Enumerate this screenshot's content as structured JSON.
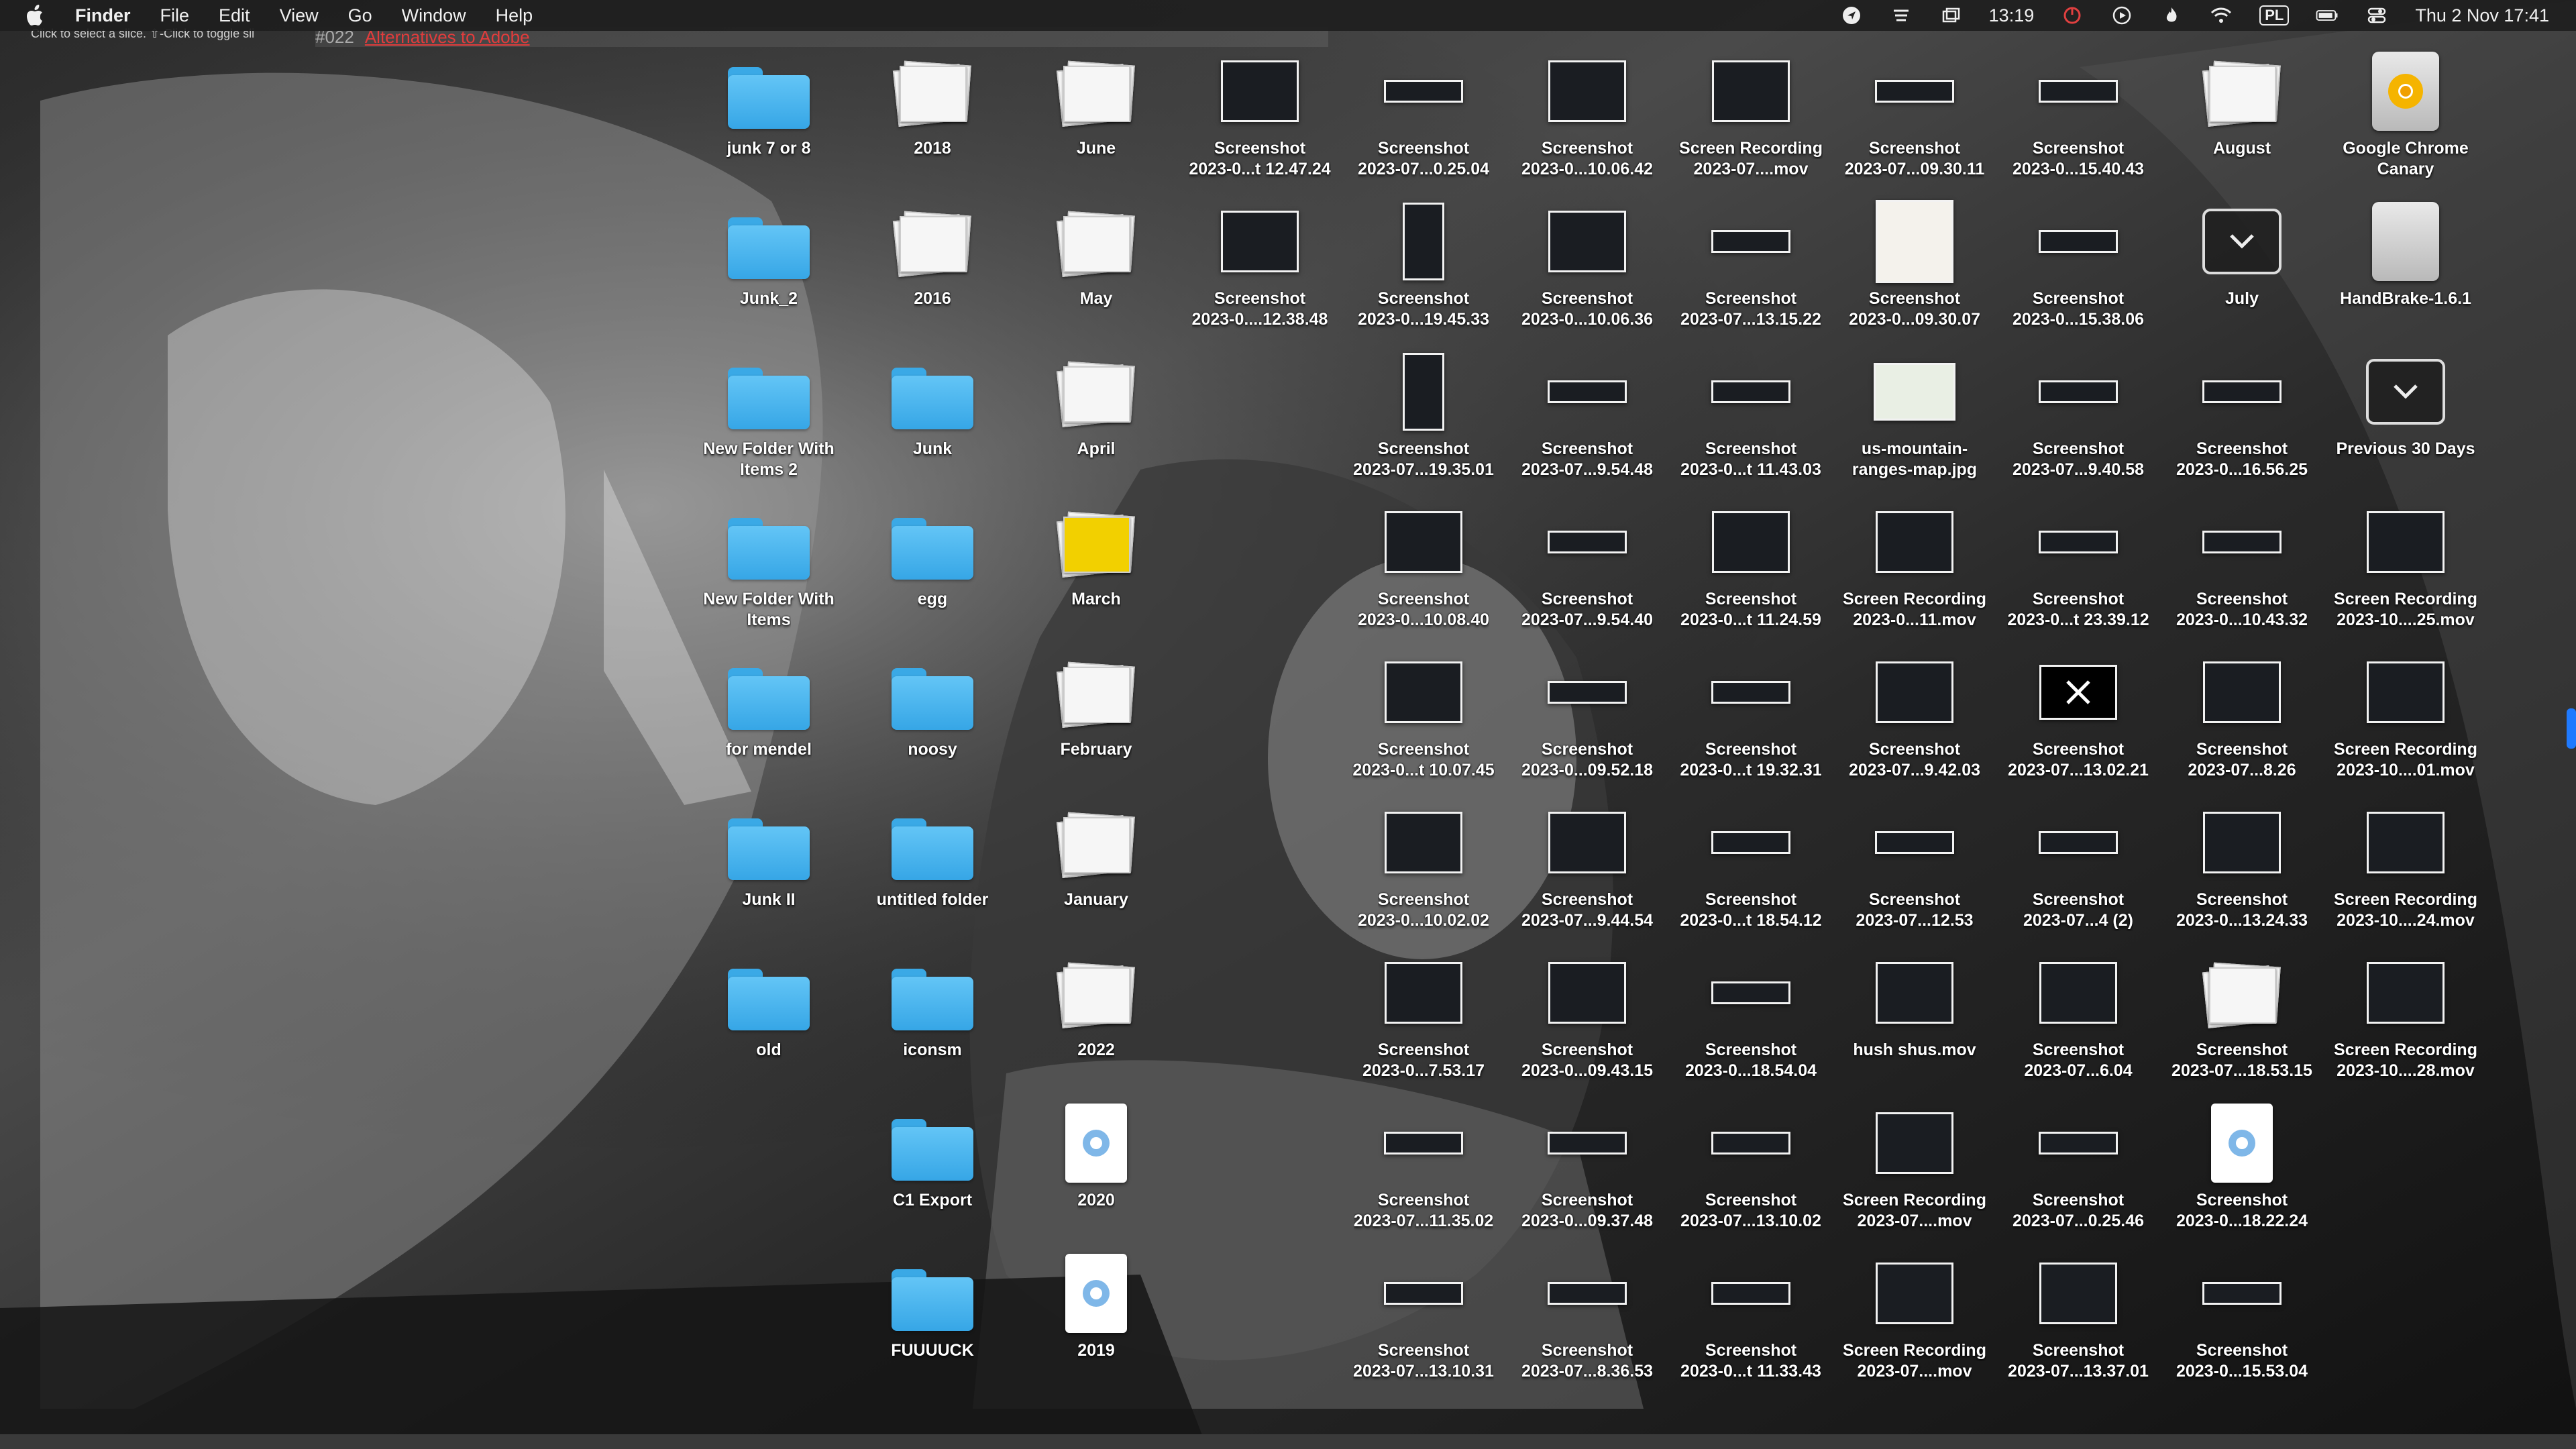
{
  "menubar": {
    "app": "Finder",
    "menus": [
      "File",
      "Edit",
      "View",
      "Go",
      "Window",
      "Help"
    ],
    "time": "13:19",
    "input_source": "PL",
    "clock": "Thu 2 Nov  17:41"
  },
  "ghost": {
    "tab_number": "#022",
    "tab_link": "Alternatives to Adobe",
    "hint": "Click to select a slice. ⇧-Click to toggle sli"
  },
  "desktop": {
    "columns": [
      {
        "items": [
          {
            "label": "junk 7 or 8",
            "label2": "",
            "kind": "folder"
          },
          {
            "label": "Junk_2",
            "label2": "",
            "kind": "folder"
          },
          {
            "label": "New Folder With",
            "label2": "Items 2",
            "kind": "folder"
          },
          {
            "label": "New Folder With",
            "label2": "Items",
            "kind": "folder"
          },
          {
            "label": "for mendel",
            "label2": "",
            "kind": "folder"
          },
          {
            "label": "Junk II",
            "label2": "",
            "kind": "folder"
          },
          {
            "label": "old",
            "label2": "",
            "kind": "folder"
          }
        ]
      },
      {
        "items": [
          {
            "label": "2018",
            "label2": "",
            "kind": "stack"
          },
          {
            "label": "2016",
            "label2": "",
            "kind": "stack"
          },
          {
            "label": "Junk",
            "label2": "",
            "kind": "folder"
          },
          {
            "label": "egg",
            "label2": "",
            "kind": "folder"
          },
          {
            "label": "noosy",
            "label2": "",
            "kind": "folder"
          },
          {
            "label": "untitled folder",
            "label2": "",
            "kind": "folder"
          },
          {
            "label": "iconsm",
            "label2": "",
            "kind": "folder"
          },
          {
            "label": "C1 Export",
            "label2": "",
            "kind": "folder"
          },
          {
            "label": "FUUUUCK",
            "label2": "",
            "kind": "folder"
          }
        ]
      },
      {
        "items": [
          {
            "label": "June",
            "label2": "",
            "kind": "stack"
          },
          {
            "label": "May",
            "label2": "",
            "kind": "stack"
          },
          {
            "label": "April",
            "label2": "",
            "kind": "stack"
          },
          {
            "label": "March",
            "label2": "",
            "kind": "stack-yellow"
          },
          {
            "label": "February",
            "label2": "",
            "kind": "stack"
          },
          {
            "label": "January",
            "label2": "",
            "kind": "stack"
          },
          {
            "label": "2022",
            "label2": "",
            "kind": "stack"
          },
          {
            "label": "2020",
            "label2": "",
            "kind": "doc"
          },
          {
            "label": "2019",
            "label2": "",
            "kind": "doc"
          }
        ]
      },
      {
        "items": [
          {
            "label": "Screenshot",
            "label2": "2023-0...t 12.47.24",
            "kind": "shot"
          },
          {
            "label": "Screenshot",
            "label2": "2023-0....12.38.48",
            "kind": "shot"
          }
        ]
      },
      {
        "items": [
          {
            "label": "Screenshot",
            "label2": "2023-07...0.25.04",
            "kind": "shot-thin"
          },
          {
            "label": "Screenshot",
            "label2": "2023-0...19.45.33",
            "kind": "shot-tall"
          },
          {
            "label": "Screenshot",
            "label2": "2023-07...19.35.01",
            "kind": "shot-tall"
          },
          {
            "label": "Screenshot",
            "label2": "2023-0...10.08.40",
            "kind": "shot"
          },
          {
            "label": "Screenshot",
            "label2": "2023-0...t 10.07.45",
            "kind": "shot"
          },
          {
            "label": "Screenshot",
            "label2": "2023-0...10.02.02",
            "kind": "shot"
          },
          {
            "label": "Screenshot",
            "label2": "2023-0...7.53.17",
            "kind": "shot"
          },
          {
            "label": "Screenshot",
            "label2": "2023-07...11.35.02",
            "kind": "shot-thin"
          },
          {
            "label": "Screenshot",
            "label2": "2023-07...13.10.31",
            "kind": "shot-thin"
          }
        ]
      },
      {
        "items": [
          {
            "label": "Screenshot",
            "label2": "2023-0...10.06.42",
            "kind": "shot"
          },
          {
            "label": "Screenshot",
            "label2": "2023-0...10.06.36",
            "kind": "shot"
          },
          {
            "label": "Screenshot",
            "label2": "2023-07...9.54.48",
            "kind": "shot-thin"
          },
          {
            "label": "Screenshot",
            "label2": "2023-07...9.54.40",
            "kind": "shot-thin"
          },
          {
            "label": "Screenshot",
            "label2": "2023-0...09.52.18",
            "kind": "shot-thin"
          },
          {
            "label": "Screenshot",
            "label2": "2023-07...9.44.54",
            "kind": "shot"
          },
          {
            "label": "Screenshot",
            "label2": "2023-0...09.43.15",
            "kind": "shot"
          },
          {
            "label": "Screenshot",
            "label2": "2023-0...09.37.48",
            "kind": "shot-thin"
          },
          {
            "label": "Screenshot",
            "label2": "2023-07...8.36.53",
            "kind": "shot-thin"
          }
        ]
      },
      {
        "items": [
          {
            "label": "Screen Recording",
            "label2": "2023-07....mov",
            "kind": "shot"
          },
          {
            "label": "Screenshot",
            "label2": "2023-07...13.15.22",
            "kind": "shot-thin"
          },
          {
            "label": "Screenshot",
            "label2": "2023-0...t 11.43.03",
            "kind": "shot-thin"
          },
          {
            "label": "Screenshot",
            "label2": "2023-0...t 11.24.59",
            "kind": "shot"
          },
          {
            "label": "Screenshot",
            "label2": "2023-0...t 19.32.31",
            "kind": "shot-thin"
          },
          {
            "label": "Screenshot",
            "label2": "2023-0...t 18.54.12",
            "kind": "shot-thin"
          },
          {
            "label": "Screenshot",
            "label2": "2023-0...18.54.04",
            "kind": "shot-thin"
          },
          {
            "label": "Screenshot",
            "label2": "2023-07...13.10.02",
            "kind": "shot-thin"
          },
          {
            "label": "Screenshot",
            "label2": "2023-0...t 11.33.43",
            "kind": "shot-thin"
          }
        ]
      },
      {
        "items": [
          {
            "label": "Screenshot",
            "label2": "2023-07...09.30.11",
            "kind": "shot-thin"
          },
          {
            "label": "Screenshot",
            "label2": "2023-0...09.30.07",
            "kind": "blank"
          },
          {
            "label": "us-mountain-",
            "label2": "ranges-map.jpg",
            "kind": "map"
          },
          {
            "label": "Screen Recording",
            "label2": "2023-0...11.mov",
            "kind": "shot"
          },
          {
            "label": "Screenshot",
            "label2": "2023-07...9.42.03",
            "kind": "shot"
          },
          {
            "label": "Screenshot",
            "label2": "2023-07...12.53",
            "kind": "shot-thin"
          },
          {
            "label": "hush shus.mov",
            "label2": "",
            "kind": "shot"
          },
          {
            "label": "Screen Recording",
            "label2": "2023-07....mov",
            "kind": "shot"
          },
          {
            "label": "Screen Recording",
            "label2": "2023-07....mov",
            "kind": "shot"
          }
        ]
      },
      {
        "items": [
          {
            "label": "Screenshot",
            "label2": "2023-0...15.40.43",
            "kind": "shot-thin"
          },
          {
            "label": "Screenshot",
            "label2": "2023-0...15.38.06",
            "kind": "shot-thin"
          },
          {
            "label": "Screenshot",
            "label2": "2023-07...9.40.58",
            "kind": "shot-thin"
          },
          {
            "label": "Screenshot",
            "label2": "2023-0...t 23.39.12",
            "kind": "shot-thin"
          },
          {
            "label": "Screenshot",
            "label2": "2023-07...13.02.21",
            "kind": "x-logo"
          },
          {
            "label": "Screenshot",
            "label2": "2023-07...4 (2)",
            "kind": "shot-thin"
          },
          {
            "label": "Screenshot",
            "label2": "2023-07...6.04",
            "kind": "shot"
          },
          {
            "label": "Screenshot",
            "label2": "2023-07...0.25.46",
            "kind": "shot-thin"
          },
          {
            "label": "Screenshot",
            "label2": "2023-07...13.37.01",
            "kind": "shot"
          }
        ]
      },
      {
        "items": [
          {
            "label": "August",
            "label2": "",
            "kind": "stack"
          },
          {
            "label": "July",
            "label2": "",
            "kind": "smart"
          },
          {
            "label": "Screenshot",
            "label2": "2023-0...16.56.25",
            "kind": "shot-thin"
          },
          {
            "label": "Screenshot",
            "label2": "2023-0...10.43.32",
            "kind": "shot-thin"
          },
          {
            "label": "Screenshot",
            "label2": "2023-07...8.26",
            "kind": "shot"
          },
          {
            "label": "Screenshot",
            "label2": "2023-0...13.24.33",
            "kind": "shot"
          },
          {
            "label": "Screenshot",
            "label2": "2023-07...18.53.15",
            "kind": "stack"
          },
          {
            "label": "Screenshot",
            "label2": "2023-0...18.22.24",
            "kind": "doc"
          },
          {
            "label": "Screenshot",
            "label2": "2023-0...15.53.04",
            "kind": "shot-thin"
          }
        ]
      },
      {
        "items": [
          {
            "label": "Google Chrome",
            "label2": "Canary",
            "kind": "drive-canary"
          },
          {
            "label": "HandBrake-1.6.1",
            "label2": "",
            "kind": "drive"
          },
          {
            "label": "Previous 30 Days",
            "label2": "",
            "kind": "smart"
          },
          {
            "label": "Screen Recording",
            "label2": "2023-10....25.mov",
            "kind": "shot"
          },
          {
            "label": "Screen Recording",
            "label2": "2023-10....01.mov",
            "kind": "shot"
          },
          {
            "label": "Screen Recording",
            "label2": "2023-10....24.mov",
            "kind": "shot"
          },
          {
            "label": "Screen Recording",
            "label2": "2023-10....28.mov",
            "kind": "shot"
          }
        ]
      }
    ]
  }
}
